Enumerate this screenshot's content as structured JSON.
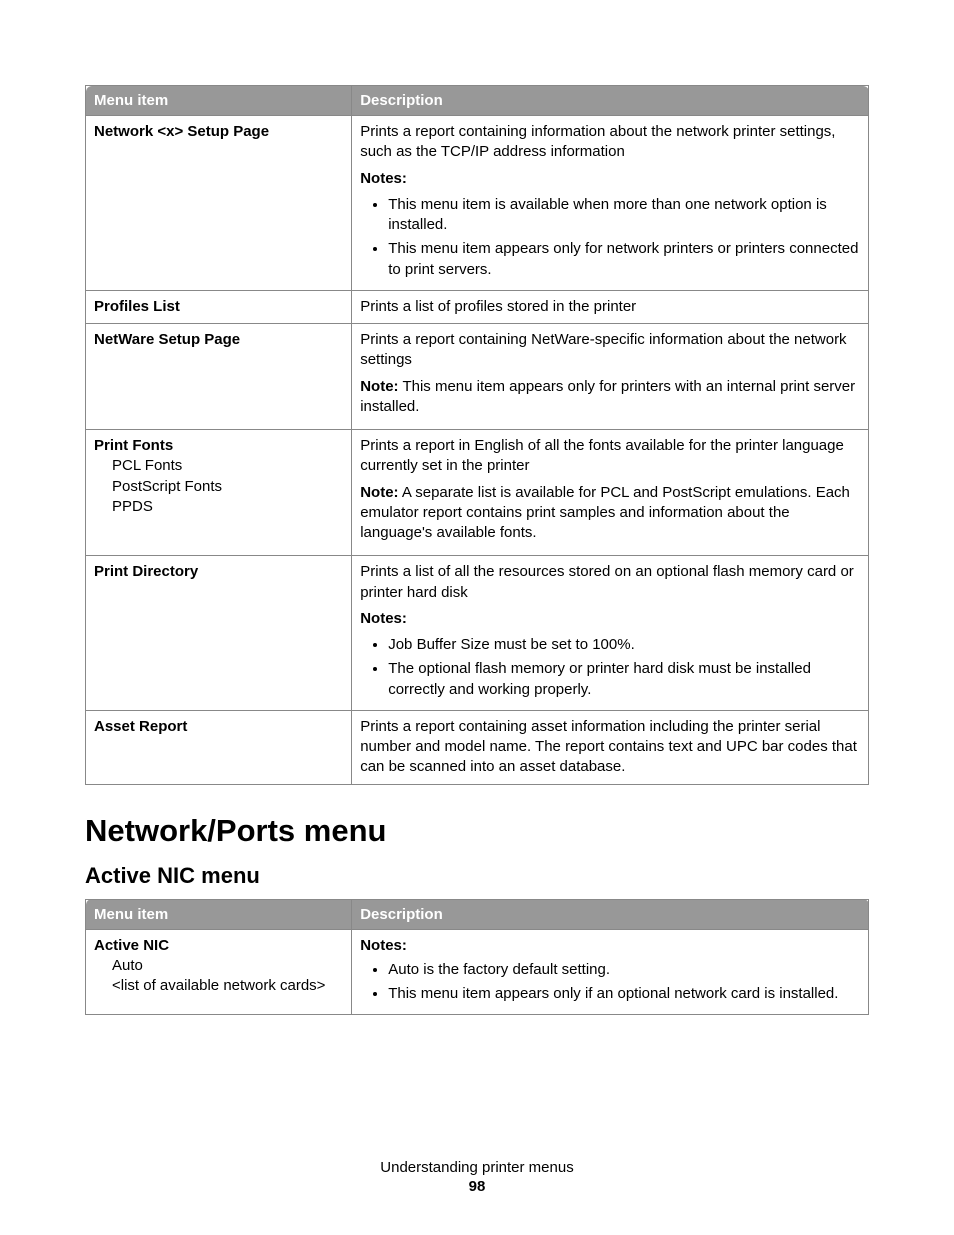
{
  "table1": {
    "headers": {
      "c1": "Menu item",
      "c2": "Description"
    },
    "rows": {
      "network_setup": {
        "name": "Network <x> Setup Page",
        "desc": "Prints a report containing information about the network printer settings, such as the TCP/IP address information",
        "notes_label": "Notes:",
        "notes": [
          "This menu item is available when more than one network option is installed.",
          "This menu item appears only for network printers or printers connected to print servers."
        ]
      },
      "profiles_list": {
        "name": "Profiles List",
        "desc": "Prints a list of profiles stored in the printer"
      },
      "netware_setup": {
        "name": "NetWare Setup Page",
        "desc": "Prints a report containing NetWare-specific information about the network settings",
        "note_label": "Note:",
        "note": " This menu item appears only for printers with an internal print server installed."
      },
      "print_fonts": {
        "name": "Print Fonts",
        "sub1": "PCL Fonts",
        "sub2": "PostScript Fonts",
        "sub3": "PPDS",
        "desc": "Prints a report in English of all the fonts available for the printer language currently set in the printer",
        "note_label": "Note:",
        "note": " A separate list is available for PCL and PostScript emulations. Each emulator report contains print samples and information about the language's available fonts."
      },
      "print_directory": {
        "name": "Print Directory",
        "desc": "Prints a list of all the resources stored on an optional flash memory card or printer hard disk",
        "notes_label": "Notes:",
        "notes": [
          "Job Buffer Size must be set to 100%.",
          "The optional flash memory or printer hard disk must be installed correctly and working properly."
        ]
      },
      "asset_report": {
        "name": "Asset Report",
        "desc": "Prints a report containing asset information including the printer serial number and model name. The report contains text and UPC bar codes that can be scanned into an asset database."
      }
    }
  },
  "section_heading": "Network/Ports menu",
  "subsection_heading": "Active NIC menu",
  "table2": {
    "headers": {
      "c1": "Menu item",
      "c2": "Description"
    },
    "rows": {
      "active_nic": {
        "name": "Active NIC",
        "sub1": "Auto",
        "sub2": "<list of available network cards>",
        "notes_label": "Notes:",
        "notes": [
          "Auto is the factory default setting.",
          "This menu item appears only if an optional network card is installed."
        ]
      }
    }
  },
  "footer": {
    "title": "Understanding printer menus",
    "page": "98"
  }
}
